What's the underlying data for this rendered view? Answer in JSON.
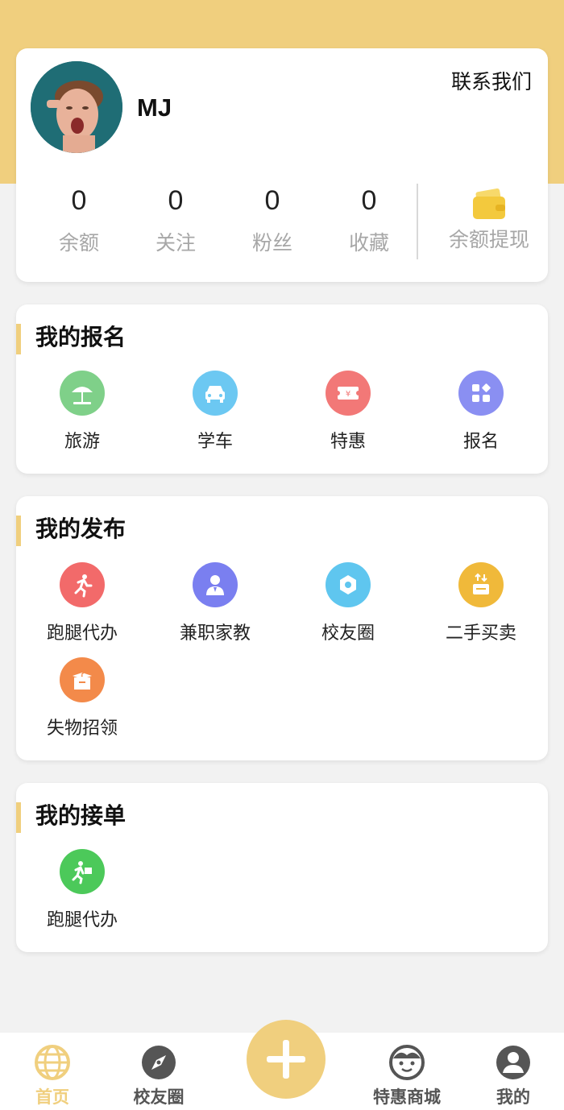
{
  "profile": {
    "username": "MJ",
    "contact_label": "联系我们",
    "stats": [
      {
        "value": "0",
        "label": "余额"
      },
      {
        "value": "0",
        "label": "关注"
      },
      {
        "value": "0",
        "label": "粉丝"
      },
      {
        "value": "0",
        "label": "收藏"
      }
    ],
    "withdraw_label": "余额提现"
  },
  "signup": {
    "title": "我的报名",
    "items": [
      {
        "label": "旅游",
        "icon": "beach-umbrella-icon",
        "color": "#7fd089"
      },
      {
        "label": "学车",
        "icon": "car-icon",
        "color": "#6cc8f2"
      },
      {
        "label": "特惠",
        "icon": "ticket-icon",
        "color": "#f27877"
      },
      {
        "label": "报名",
        "icon": "apps-icon",
        "color": "#8a8ff2"
      }
    ]
  },
  "publish": {
    "title": "我的发布",
    "items": [
      {
        "label": "跑腿代办",
        "icon": "runner-icon",
        "color": "#f26a6a"
      },
      {
        "label": "兼职家教",
        "icon": "tutor-icon",
        "color": "#7a7ff0"
      },
      {
        "label": "校友圈",
        "icon": "hexagon-icon",
        "color": "#5fc6ef"
      },
      {
        "label": "二手买卖",
        "icon": "trade-icon",
        "color": "#f0b93a"
      },
      {
        "label": "失物招领",
        "icon": "lost-box-icon",
        "color": "#f38a4a"
      }
    ]
  },
  "orders": {
    "title": "我的接单",
    "items": [
      {
        "label": "跑腿代办",
        "icon": "delivery-runner-icon",
        "color": "#4cc95a"
      }
    ]
  },
  "tabbar": {
    "tabs": [
      {
        "label": "首页",
        "icon": "globe-icon",
        "active": true
      },
      {
        "label": "校友圈",
        "icon": "compass-icon",
        "active": false
      },
      {
        "label": "特惠商城",
        "icon": "face-icon",
        "active": false
      },
      {
        "label": "我的",
        "icon": "user-icon",
        "active": false
      }
    ],
    "center_icon": "plus-icon"
  },
  "colors": {
    "accent": "#f0cf7e",
    "muted_text": "#a7a7a7"
  }
}
